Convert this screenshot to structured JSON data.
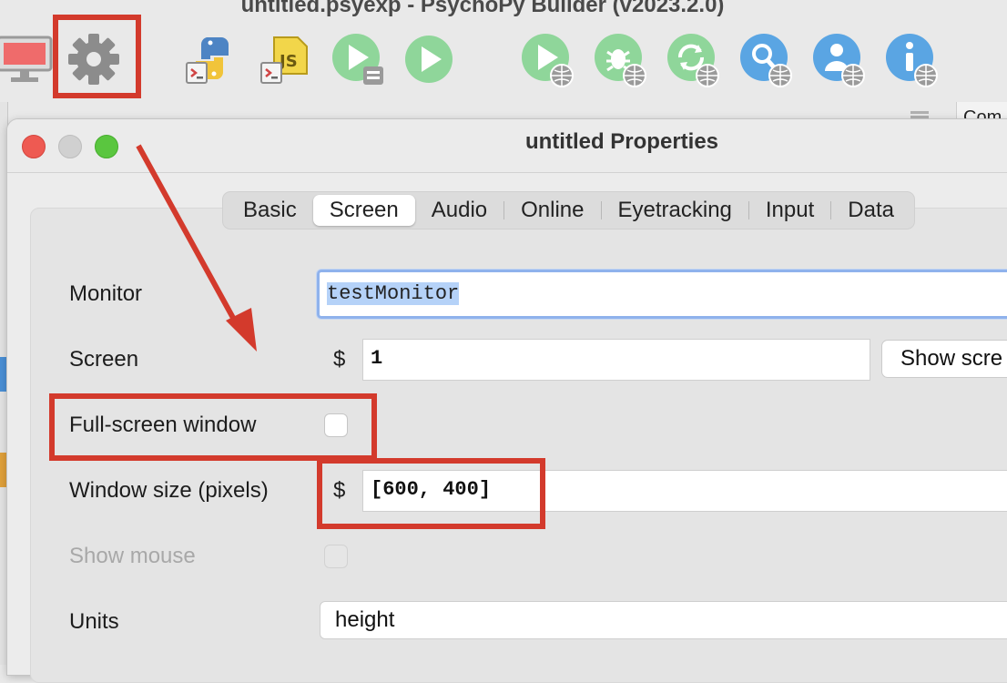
{
  "app": {
    "window_title": "untitled.psyexp - PsychoPy Builder (v2023.2.0)"
  },
  "toolbar": {
    "buttons": [
      {
        "icon": "monitor-icon",
        "label": "Monitor Center"
      },
      {
        "icon": "gear-icon",
        "label": "Experiment Settings"
      },
      {
        "icon": "python-icon",
        "label": "Compile Python"
      },
      {
        "icon": "js-icon",
        "label": "Compile JS"
      },
      {
        "icon": "run-pilot-icon",
        "label": "Pilot"
      },
      {
        "icon": "run-icon",
        "label": "Run"
      },
      {
        "icon": "run-online-icon",
        "label": "Pilot online"
      },
      {
        "icon": "bug-online-icon",
        "label": "Debug online"
      },
      {
        "icon": "sync-online-icon",
        "label": "Sync"
      },
      {
        "icon": "search-online-icon",
        "label": "Search Pavlovia"
      },
      {
        "icon": "user-online-icon",
        "label": "User"
      },
      {
        "icon": "info-online-icon",
        "label": "Project info"
      }
    ]
  },
  "background": {
    "right_strip_label": "Com"
  },
  "dialog": {
    "title": "untitled Properties",
    "tabs": [
      {
        "label": "Basic",
        "active": false
      },
      {
        "label": "Screen",
        "active": true
      },
      {
        "label": "Audio",
        "active": false
      },
      {
        "label": "Online",
        "active": false
      },
      {
        "label": "Eyetracking",
        "active": false
      },
      {
        "label": "Input",
        "active": false
      },
      {
        "label": "Data",
        "active": false
      }
    ],
    "fields": {
      "monitor": {
        "label": "Monitor",
        "value": "testMonitor"
      },
      "screen": {
        "label": "Screen",
        "prefix": "$",
        "value": "1",
        "button": "Show scre"
      },
      "fullscreen": {
        "label": "Full-screen window",
        "checked": false
      },
      "window_size": {
        "label": "Window size (pixels)",
        "prefix": "$",
        "value": "[600, 400]"
      },
      "show_mouse": {
        "label": "Show mouse",
        "checked": false,
        "disabled": true
      },
      "units": {
        "label": "Units",
        "value": "height"
      }
    }
  },
  "colors": {
    "annotation_red": "#d33a2c",
    "light_red": "#ee5a52",
    "light_yellow": "#d0d0d0",
    "light_green": "#5ac63f",
    "icon_green": "#7fcf83",
    "icon_blue": "#5aa5e3"
  }
}
